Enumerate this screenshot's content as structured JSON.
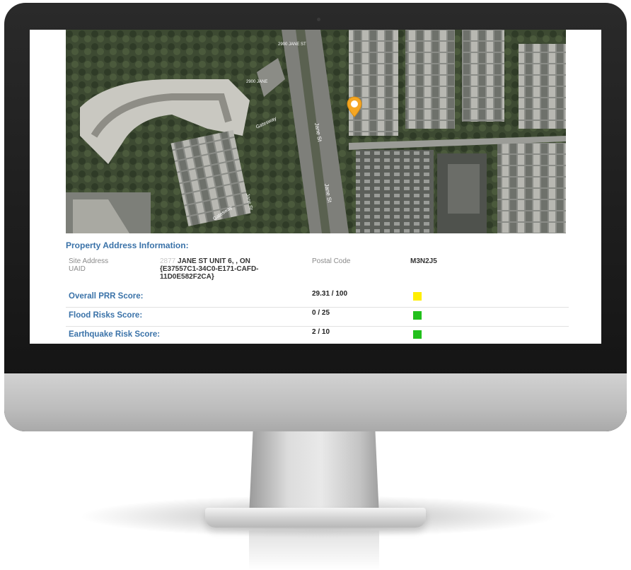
{
  "map": {
    "labels": [
      "2900 JANE ST",
      "2900 JANE",
      "Jane St",
      "Jane St",
      "Jane St",
      "Gatesway",
      "Gatesway"
    ],
    "marker_color": "#f5a623"
  },
  "property": {
    "section_title": "Property Address Information:",
    "site_address_label": "Site Address",
    "uaid_label": "UAID",
    "address_number": "2877",
    "address_rest": "JANE ST UNIT 6, , ON",
    "uaid_line1": "{E37557C1-34C0-E171-CAFD-",
    "uaid_line2": "11D0E582F2CA}",
    "postal_code_label": "Postal Code",
    "postal_code": "M3N2J5"
  },
  "scores": [
    {
      "label": "Overall PRR Score:",
      "value": "29.31 / 100",
      "color": "#ffee00"
    },
    {
      "label": "Flood Risks Score:",
      "value": "0 / 25",
      "color": "#22c01c"
    },
    {
      "label": "Earthquake Risk Score:",
      "value": "2 / 10",
      "color": "#22c01c"
    }
  ]
}
